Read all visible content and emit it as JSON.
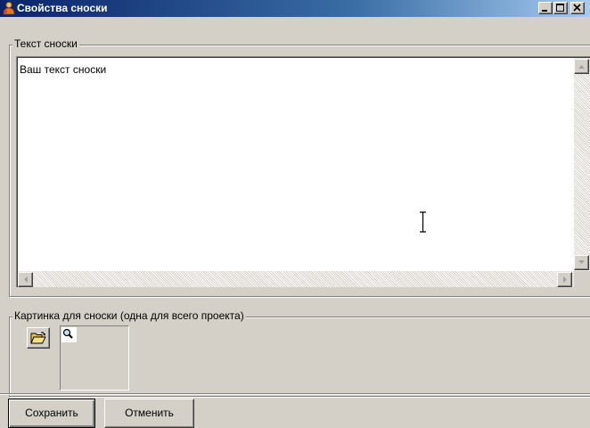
{
  "window": {
    "title": "Свойства сноски",
    "icon": "app-person-icon",
    "controls": {
      "minimize": "minimize-icon",
      "maximize": "maximize-icon",
      "close": "close-icon"
    }
  },
  "footnote_text_group": {
    "legend": "Текст сноски",
    "memo_value": "Ваш текст сноски"
  },
  "picture_group": {
    "legend": "Картинка для сноски (одна для всего проекта)",
    "open_icon": "folder-open-icon",
    "thumbnail_icon": "magnifier-icon"
  },
  "buttons": {
    "save": "Сохранить",
    "cancel": "Отменить"
  },
  "colors": {
    "titlebar_start": "#0a246a",
    "titlebar_end": "#a6caf0",
    "face": "#d4d0c8"
  }
}
